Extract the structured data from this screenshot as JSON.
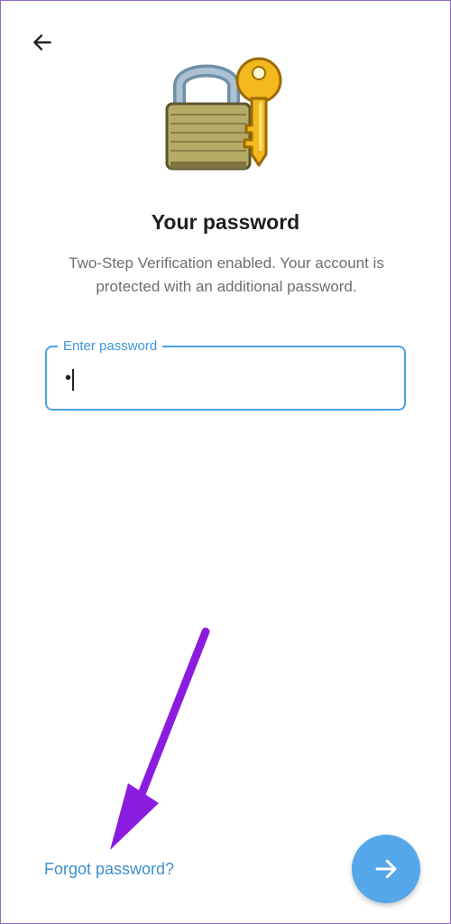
{
  "header": {
    "back_icon": "arrow-left-icon"
  },
  "hero": {
    "icon": "padlock-and-key-icon"
  },
  "content": {
    "title": "Your password",
    "subtitle": "Two-Step Verification enabled. Your account is protected with an additional password."
  },
  "password_field": {
    "label": "Enter password",
    "value": "•"
  },
  "footer": {
    "forgot_label": "Forgot password?",
    "next_icon": "arrow-right-icon"
  },
  "colors": {
    "accent": "#4ba2e2",
    "fab": "#55a7ea",
    "link": "#3b8fd1",
    "annotation_arrow": "#8c1be0"
  }
}
